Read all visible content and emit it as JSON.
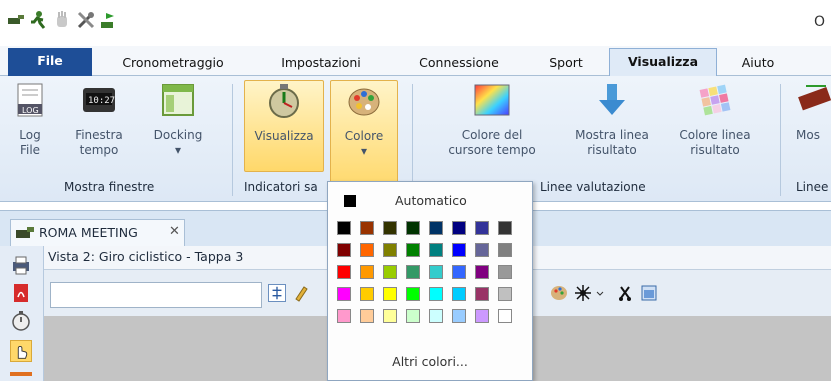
{
  "window": {
    "title_fragment": "O"
  },
  "quick_access": [
    "pin-icon",
    "runner-icon",
    "hand-icon",
    "tools-icon",
    "flag-icon"
  ],
  "tabs": [
    {
      "label": "File"
    },
    {
      "label": "Cronometraggio"
    },
    {
      "label": "Impostazioni"
    },
    {
      "label": "Connessione"
    },
    {
      "label": "Sport"
    },
    {
      "label": "Visualizza"
    },
    {
      "label": "Aiuto"
    }
  ],
  "ribbon": {
    "log_file": "Log\nFile",
    "finestra_tempo": "Finestra\ntempo",
    "docking": "Docking",
    "visualizza": "Visualizza",
    "colore": "Colore",
    "colore_cursore": "Colore del\ncursore tempo",
    "mostra_linea": "Mostra linea\nrisultato",
    "colore_linea": "Colore linea\nrisultato",
    "mostra_cut": "Mos",
    "group_mostra_finestre": "Mostra finestre",
    "group_indicatori": "Indicatori sa",
    "group_linee_valutazione": "Linee valutazione",
    "group_linee_cut": "Linee",
    "dropdown_arrow": "▾"
  },
  "document": {
    "tab_label": "ROMA MEETING",
    "close": "✕",
    "view_title": "Vista 2: Giro ciclistico - Tappa 3"
  },
  "color_menu": {
    "automatic_label": "Automatico",
    "more_colors_label": "Altri colori...",
    "swatches": [
      [
        "#000000",
        "#993300",
        "#333300",
        "#003300",
        "#003366",
        "#000080",
        "#333399",
        "#333333"
      ],
      [
        "#800000",
        "#ff6600",
        "#808000",
        "#008000",
        "#008080",
        "#0000ff",
        "#666699",
        "#808080"
      ],
      [
        "#ff0000",
        "#ff9900",
        "#99cc00",
        "#339966",
        "#33cccc",
        "#3366ff",
        "#800080",
        "#999999"
      ],
      [
        "#ff00ff",
        "#ffcc00",
        "#ffff00",
        "#00ff00",
        "#00ffff",
        "#00ccff",
        "#993366",
        "#c0c0c0"
      ],
      [
        "#ff99cc",
        "#ffcc99",
        "#ffff99",
        "#ccffcc",
        "#ccffff",
        "#99ccff",
        "#cc99ff",
        "#ffffff"
      ]
    ]
  },
  "colors": {
    "accent": "#1e4e97",
    "ribbon_bg": "#e3ecf7",
    "selected": "#ffd86a"
  }
}
